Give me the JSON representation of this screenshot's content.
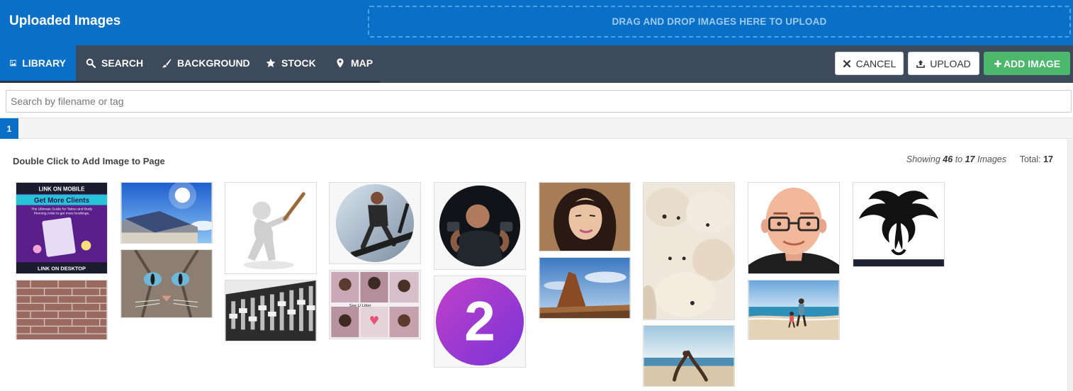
{
  "header": {
    "title": "Uploaded Images",
    "dropzone_text": "DRAG AND DROP IMAGES HERE TO UPLOAD"
  },
  "tabs": [
    {
      "label": "LIBRARY",
      "icon": "image-icon",
      "active": true
    },
    {
      "label": "SEARCH",
      "icon": "search-icon",
      "active": false
    },
    {
      "label": "BACKGROUND",
      "icon": "brush-icon",
      "active": false
    },
    {
      "label": "STOCK",
      "icon": "star-icon",
      "active": false
    },
    {
      "label": "MAP",
      "icon": "map-marker-icon",
      "active": false
    }
  ],
  "actions": {
    "cancel": "CANCEL",
    "upload": "UPLOAD",
    "add_image": "ADD IMAGE"
  },
  "search": {
    "placeholder": "Search by filename or tag",
    "value": ""
  },
  "pagination": {
    "current": "1"
  },
  "content": {
    "hint": "Double Click to Add Image to Page",
    "showing_prefix": "Showing",
    "showing_from": "46",
    "showing_to_word": "to",
    "showing_to": "17",
    "showing_suffix": "Images",
    "total_label": "Total:",
    "total_value": "17"
  },
  "images": {
    "promo_title_top": "LINK ON MOBILE",
    "promo_headline": "Get More Clients",
    "promo_subtext_1": "The Ultimate Guide for Tattoo and Body",
    "promo_subtext_2": "Piercing Artist to get more bookings.",
    "promo_title_bottom": "LINK ON DESKTOP",
    "collage_caption": "See U Litter",
    "number_badge": "2"
  },
  "colors": {
    "brand_blue": "#0a6fc6",
    "nav_dark": "#3d4a5c",
    "add_green": "#4cb86b"
  }
}
